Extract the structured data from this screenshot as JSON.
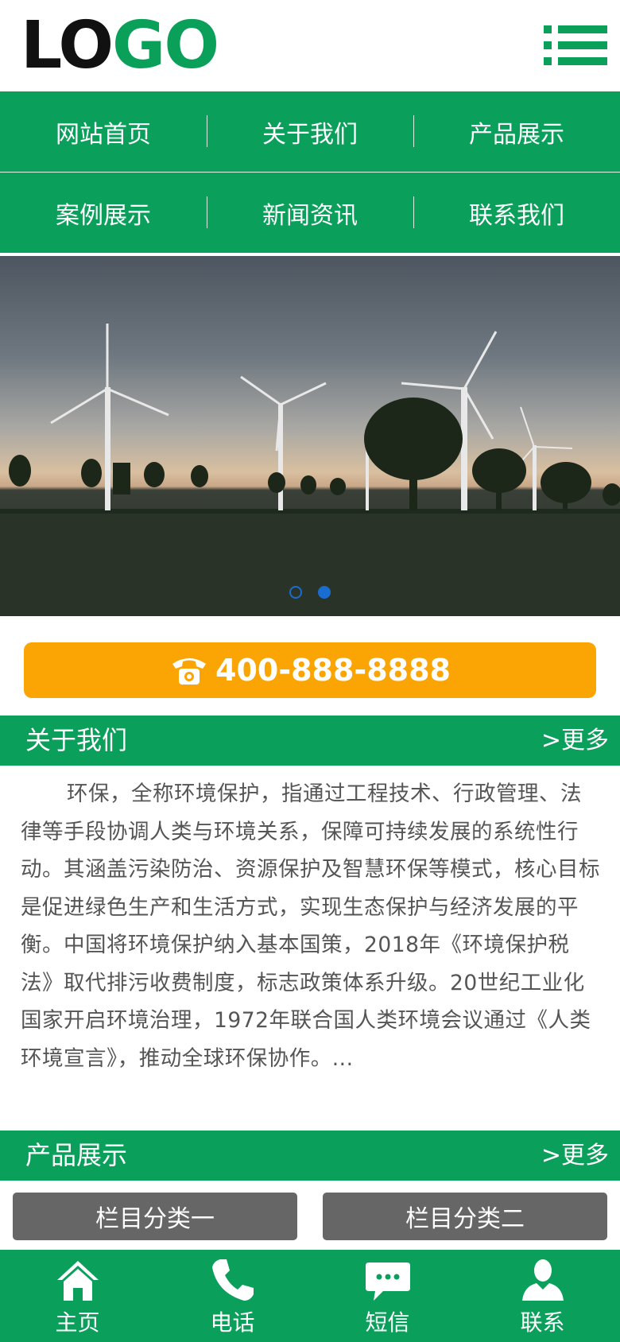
{
  "logo": {
    "part1": "LO",
    "part2": "GO"
  },
  "nav": {
    "items": [
      "网站首页",
      "关于我们",
      "产品展示",
      "案例展示",
      "新闻资讯",
      "联系我们"
    ]
  },
  "banner": {
    "slides": 2,
    "active_slide": 2
  },
  "phone": {
    "number": "400-888-8888"
  },
  "about": {
    "title": "关于我们",
    "more": ">更多",
    "text": "环保，全称环境保护，指通过工程技术、行政管理、法律等手段协调人类与环境关系，保障可持续发展的系统性行动。其涵盖污染防治、资源保护及智慧环保等模式，核心目标是促进绿色生产和生活方式，实现生态保护与经济发展的平衡。中国将环境保护纳入基本国策，2018年《环境保护税法》取代排污收费制度，标志政策体系升级。20世纪工业化国家开启环境治理，1972年联合国人类环境会议通过《人类环境宣言》，推动全球环保协作。..."
  },
  "products": {
    "title": "产品展示",
    "more": ">更多",
    "categories": [
      "栏目分类一",
      "栏目分类二"
    ]
  },
  "footer": {
    "items": [
      {
        "label": "主页",
        "icon": "home-icon"
      },
      {
        "label": "电话",
        "icon": "phone-icon"
      },
      {
        "label": "短信",
        "icon": "message-icon"
      },
      {
        "label": "联系",
        "icon": "contact-icon"
      }
    ]
  },
  "colors": {
    "brand_green": "#0a9f5a",
    "phone_orange": "#fba505",
    "category_gray": "#666666",
    "indicator_blue": "#1a6dd0"
  }
}
